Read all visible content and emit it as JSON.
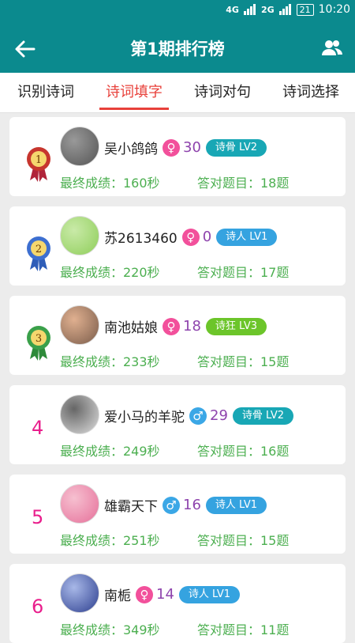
{
  "status_bar": {
    "network1": "4G",
    "network2": "2G",
    "network3": "2G",
    "battery": "21",
    "time": "10:20"
  },
  "app_bar": {
    "title": "第1期排行榜"
  },
  "tabs": [
    {
      "label": "识别诗词",
      "active": false
    },
    {
      "label": "诗词填字",
      "active": true
    },
    {
      "label": "诗词对句",
      "active": false
    },
    {
      "label": "诗词选择",
      "active": false
    }
  ],
  "rows": [
    {
      "rank": "1",
      "medal": true,
      "name": "吴小鸽鸽",
      "gender": "female",
      "level_num": "30",
      "badge": "诗骨 LV2",
      "badge_color": "#18a7b5",
      "score": "最终成绩：160秒",
      "answers": "答对题目：18题"
    },
    {
      "rank": "2",
      "medal": true,
      "name": "苏2613460",
      "gender": "female",
      "level_num": "0",
      "badge": "诗人 LV1",
      "badge_color": "#35a3e0",
      "score": "最终成绩：220秒",
      "answers": "答对题目：17题"
    },
    {
      "rank": "3",
      "medal": true,
      "name": "南池姑娘",
      "gender": "female",
      "level_num": "18",
      "badge": "诗狂 LV3",
      "badge_color": "#6cc52a",
      "score": "最终成绩：233秒",
      "answers": "答对题目：15题"
    },
    {
      "rank": "4",
      "medal": false,
      "name": "爱小马的羊驼",
      "gender": "male",
      "level_num": "29",
      "badge": "诗骨 LV2",
      "badge_color": "#18a7b5",
      "score": "最终成绩：249秒",
      "answers": "答对题目：16题"
    },
    {
      "rank": "5",
      "medal": false,
      "name": "雄霸天下",
      "gender": "male",
      "level_num": "16",
      "badge": "诗人 LV1",
      "badge_color": "#35a3e0",
      "score": "最终成绩：251秒",
      "answers": "答对题目：15题"
    },
    {
      "rank": "6",
      "medal": false,
      "name": "南栀",
      "gender": "female",
      "level_num": "14",
      "badge": "诗人 LV1",
      "badge_color": "#35a3e0",
      "score": "最终成绩：349秒",
      "answers": "答对题目：11题"
    }
  ],
  "colors": {
    "primary": "#0b8a8e",
    "tab_active": "#e8403a",
    "meta_text": "#4caf50"
  }
}
